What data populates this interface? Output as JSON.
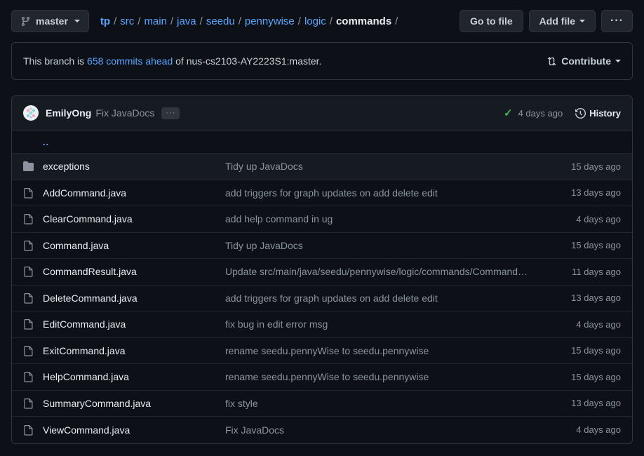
{
  "toolbar": {
    "branch": {
      "name": "master",
      "icon": "git-branch-icon"
    },
    "breadcrumb": {
      "segments": [
        {
          "label": "tp",
          "link": true,
          "root": true
        },
        {
          "label": "src",
          "link": true
        },
        {
          "label": "main",
          "link": true
        },
        {
          "label": "java",
          "link": true
        },
        {
          "label": "seedu",
          "link": true
        },
        {
          "label": "pennywise",
          "link": true
        },
        {
          "label": "logic",
          "link": true
        },
        {
          "label": "commands",
          "link": false
        }
      ],
      "separator": "/",
      "trailing_separator": "/"
    },
    "go_to_file_label": "Go to file",
    "add_file_label": "Add file",
    "more_options_label": "···"
  },
  "banner": {
    "prefix": "This branch is",
    "link_text": "658 commits ahead",
    "suffix": "of nus-cs2103-AY2223S1:master.",
    "contribute_label": "Contribute",
    "contribute_icon": "git-compare-icon"
  },
  "commit_header": {
    "author": "EmilyOng",
    "message": "Fix JavaDocs",
    "expand_label": "···",
    "status_icon": "check-icon",
    "status_color": "#3fb950",
    "time": "4 days ago",
    "history_label": "History",
    "history_icon": "clock-history-icon",
    "avatar": "user-avatar"
  },
  "file_list": {
    "parent_label": "..",
    "rows": [
      {
        "icon": "folder-icon",
        "type": "dir",
        "name": "exceptions",
        "message": "Tidy up JavaDocs",
        "time": "15 days ago",
        "hover": true
      },
      {
        "icon": "file-icon",
        "type": "file",
        "name": "AddCommand.java",
        "message": "add triggers for graph updates on add delete edit",
        "time": "13 days ago",
        "hover": false
      },
      {
        "icon": "file-icon",
        "type": "file",
        "name": "ClearCommand.java",
        "message": "add help command in ug",
        "time": "4 days ago",
        "hover": false
      },
      {
        "icon": "file-icon",
        "type": "file",
        "name": "Command.java",
        "message": "Tidy up JavaDocs",
        "time": "15 days ago",
        "hover": false
      },
      {
        "icon": "file-icon",
        "type": "file",
        "name": "CommandResult.java",
        "message": "Update src/main/java/seedu/pennywise/logic/commands/Command…",
        "time": "11 days ago",
        "hover": false
      },
      {
        "icon": "file-icon",
        "type": "file",
        "name": "DeleteCommand.java",
        "message": "add triggers for graph updates on add delete edit",
        "time": "13 days ago",
        "hover": false
      },
      {
        "icon": "file-icon",
        "type": "file",
        "name": "EditCommand.java",
        "message": "fix bug in edit error msg",
        "time": "4 days ago",
        "hover": false
      },
      {
        "icon": "file-icon",
        "type": "file",
        "name": "ExitCommand.java",
        "message": "rename seedu.pennyWise to seedu.pennywise",
        "time": "15 days ago",
        "hover": false
      },
      {
        "icon": "file-icon",
        "type": "file",
        "name": "HelpCommand.java",
        "message": "rename seedu.pennyWise to seedu.pennywise",
        "time": "15 days ago",
        "hover": false
      },
      {
        "icon": "file-icon",
        "type": "file",
        "name": "SummaryCommand.java",
        "message": "fix style",
        "time": "13 days ago",
        "hover": false
      },
      {
        "icon": "file-icon",
        "type": "file",
        "name": "ViewCommand.java",
        "message": "Fix JavaDocs",
        "time": "4 days ago",
        "hover": false
      }
    ]
  },
  "colors": {
    "page_bg": "#0d1117",
    "panel_bg": "#0d1117",
    "header_bg": "#161b22",
    "border": "#30363d",
    "link": "#58a6ff",
    "muted": "#8b949e",
    "text": "#e6edf3",
    "success": "#3fb950"
  }
}
